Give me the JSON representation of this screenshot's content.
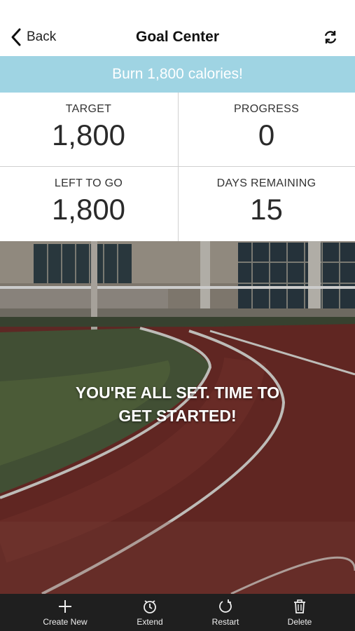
{
  "nav": {
    "back_label": "Back",
    "title": "Goal Center",
    "refresh_icon": "refresh-icon"
  },
  "banner": {
    "text": "Burn 1,800 calories!",
    "color": "#9fd4e3"
  },
  "stats": {
    "target": {
      "label": "TARGET",
      "value": "1,800"
    },
    "progress": {
      "label": "PROGRESS",
      "value": "0"
    },
    "left": {
      "label": "LEFT TO GO",
      "value": "1,800"
    },
    "days": {
      "label": "DAYS REMAINING",
      "value": "15"
    }
  },
  "hero": {
    "message_line1": "YOU'RE ALL SET. TIME TO",
    "message_line2": "GET STARTED!"
  },
  "toolbar": {
    "create": {
      "label": "Create New",
      "icon": "plus-icon"
    },
    "extend": {
      "label": "Extend",
      "icon": "clock-icon"
    },
    "restart": {
      "label": "Restart",
      "icon": "restart-icon"
    },
    "delete": {
      "label": "Delete",
      "icon": "trash-icon"
    }
  }
}
